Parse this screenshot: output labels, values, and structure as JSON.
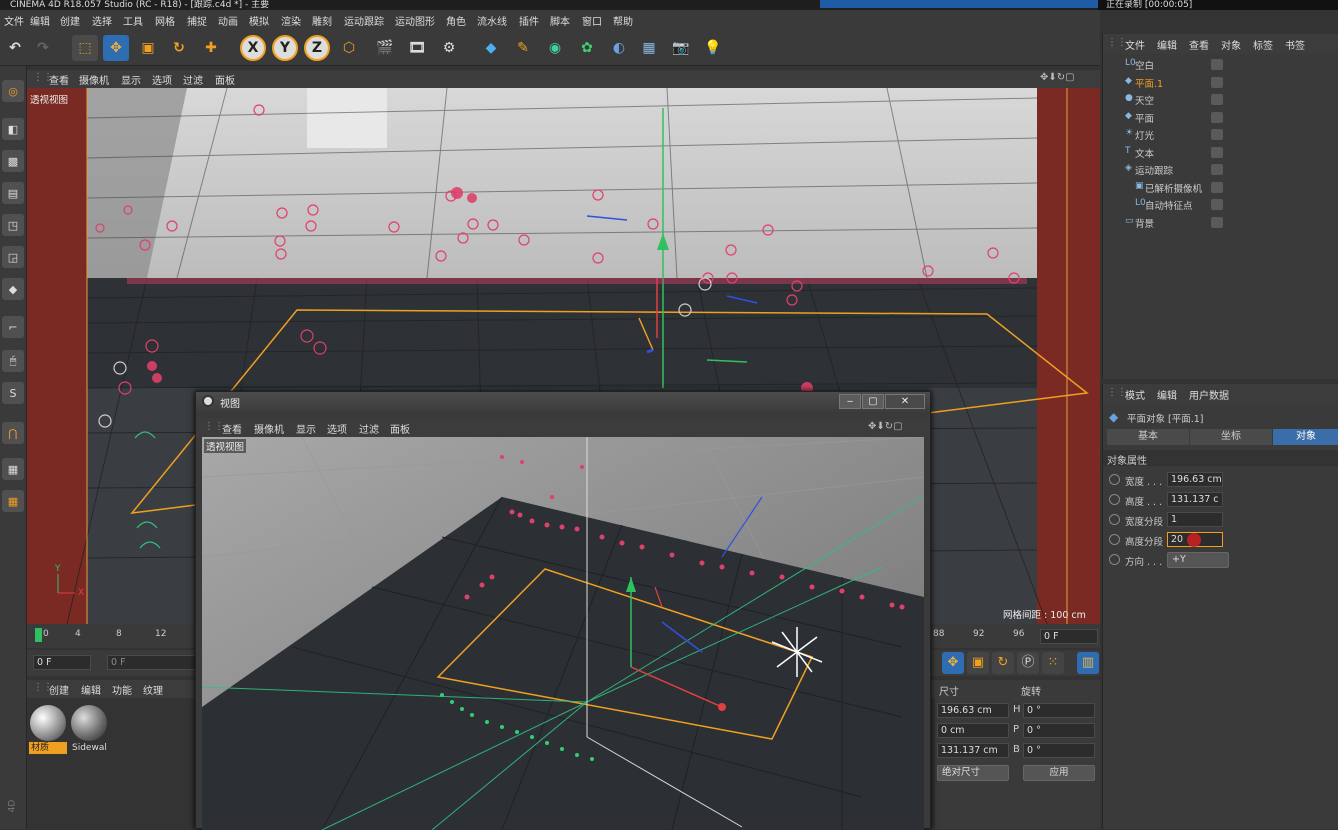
{
  "window": {
    "title": "CINEMA 4D R18.057 Studio (RC - R18) - [跟踪.c4d *] - 主要",
    "recording": "正在录制 [00:00:05]"
  },
  "menu": [
    "文件",
    "编辑",
    "创建",
    "选择",
    "工具",
    "网格",
    "捕捉",
    "动画",
    "模拟",
    "渲染",
    "雕刻",
    "运动跟踪",
    "运动图形",
    "角色",
    "流水线",
    "插件",
    "脚本",
    "窗口",
    "帮助"
  ],
  "toolbar": {
    "axes": [
      "X",
      "Y",
      "Z"
    ]
  },
  "viewport": {
    "menu": [
      "查看",
      "摄像机",
      "显示",
      "选项",
      "过滤",
      "面板"
    ],
    "name": "透视视图",
    "grid_label": "网格间距 : 100 cm"
  },
  "timeline": {
    "ticks_left": [
      "0",
      "4",
      "8",
      "12"
    ],
    "ticks_right": [
      "88",
      "92",
      "96"
    ],
    "frame_right": "0 F",
    "start": "0 F",
    "current": "0 F"
  },
  "material_manager": {
    "menu": [
      "创建",
      "编辑",
      "功能",
      "纹理"
    ],
    "materials": [
      {
        "name": "材质"
      },
      {
        "name": "Sidewal"
      }
    ]
  },
  "coordinates": {
    "headers": [
      "尺寸",
      "旋转"
    ],
    "size": [
      "196.63 cm",
      "0 cm",
      "131.137 cm"
    ],
    "rot_labels": [
      "H",
      "P",
      "B"
    ],
    "rotation": [
      "0 °",
      "0 °",
      "0 °"
    ],
    "mode": "绝对尺寸",
    "apply": "应用"
  },
  "object_manager": {
    "menu": [
      "文件",
      "编辑",
      "查看",
      "对象",
      "标签",
      "书签"
    ],
    "objects": [
      {
        "name": "空白",
        "icon": "null-icon",
        "color": "#ccc"
      },
      {
        "name": "平面.1",
        "icon": "plane-icon",
        "color": "#f0a020"
      },
      {
        "name": "天空",
        "icon": "sky-icon",
        "color": "#ccc"
      },
      {
        "name": "平面",
        "icon": "plane-icon",
        "color": "#ccc"
      },
      {
        "name": "灯光",
        "icon": "light-icon",
        "color": "#ccc"
      },
      {
        "name": "文本",
        "icon": "text-icon",
        "color": "#ccc"
      },
      {
        "name": "运动跟踪",
        "icon": "motion-tracker-icon",
        "color": "#ccc"
      },
      {
        "name": "已解析摄像机",
        "icon": "camera-icon",
        "color": "#ccc"
      },
      {
        "name": "自动特征点",
        "icon": "null-icon",
        "color": "#ccc"
      },
      {
        "name": "背景",
        "icon": "background-icon",
        "color": "#ccc"
      }
    ]
  },
  "attributes": {
    "menu": [
      "模式",
      "编辑",
      "用户数据"
    ],
    "object_title": "平面对象 [平面.1]",
    "tabs": [
      "基本",
      "坐标",
      "对象"
    ],
    "section": "对象属性",
    "fields": [
      {
        "label": "宽度 . . .",
        "value": "196.63 cm"
      },
      {
        "label": "高度 . . .",
        "value": "131.137 c"
      },
      {
        "label": "宽度分段",
        "value": "1"
      },
      {
        "label": "高度分段",
        "value": "20"
      },
      {
        "label": "方向 . . .",
        "value": "+Y"
      }
    ]
  },
  "subwindow": {
    "title": "视图",
    "menu": [
      "查看",
      "摄像机",
      "显示",
      "选项",
      "过滤",
      "面板"
    ],
    "name": "透视视图"
  },
  "colors": {
    "accent": "#f0a020",
    "active_tab": "#3b6ea8",
    "track_point": "#e0406a",
    "green_point": "#30d070"
  }
}
